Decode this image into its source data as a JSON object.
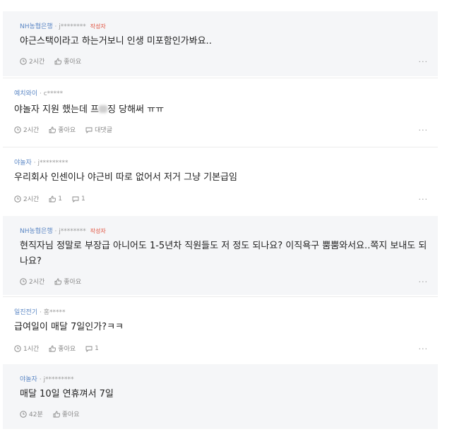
{
  "comments": [
    {
      "company": "NH농협은행",
      "author": "· j********",
      "badge": "작성자",
      "text": "야근스택이라고 하는거보니 인생 미포함인가봐요..",
      "time": "2시간",
      "like": "좋아요"
    },
    {
      "company": "예치와이",
      "author": "· c*****",
      "text_before": "야놀자 지원 했는데 프",
      "text_after": "징 당해써 ㅠㅠ",
      "time": "2시간",
      "like": "좋아요",
      "reply": "대댓글"
    },
    {
      "company": "야놀자",
      "author": "· j*********",
      "text": "우리회사 인센이나 야근비 따로 없어서 저거 그냥 기본급임",
      "time": "2시간",
      "like": "1",
      "reply": "1"
    },
    {
      "company": "NH농협은행",
      "author": "· j********",
      "badge": "작성자",
      "text": "현직자님 정말로 부장급 아니어도 1-5년차 직원들도 저 정도 되나요? 이직욕구 뿜뿜와서요..쪽지 보내도 되나요?",
      "time": "2시간",
      "like": "좋아요"
    },
    {
      "company": "일진전기",
      "author": "· 홍*****",
      "text": "급여일이 매달 7일인가?ㅋㅋ",
      "time": "1시간",
      "like": "좋아요",
      "reply": "1"
    },
    {
      "company": "야놀자",
      "author": "· j*********",
      "text": "매달 10일 연휴껴서 7일",
      "time": "42분",
      "like": "좋아요"
    }
  ],
  "more_label": "...",
  "icons": {
    "clock": "clock-icon",
    "like": "thumbs-up-icon",
    "reply": "speech-bubble-icon",
    "more": "more-icon"
  },
  "colors": {
    "company": "#5a86c4",
    "badge": "#e0503c",
    "reply_bg": "#f5f6f8"
  }
}
